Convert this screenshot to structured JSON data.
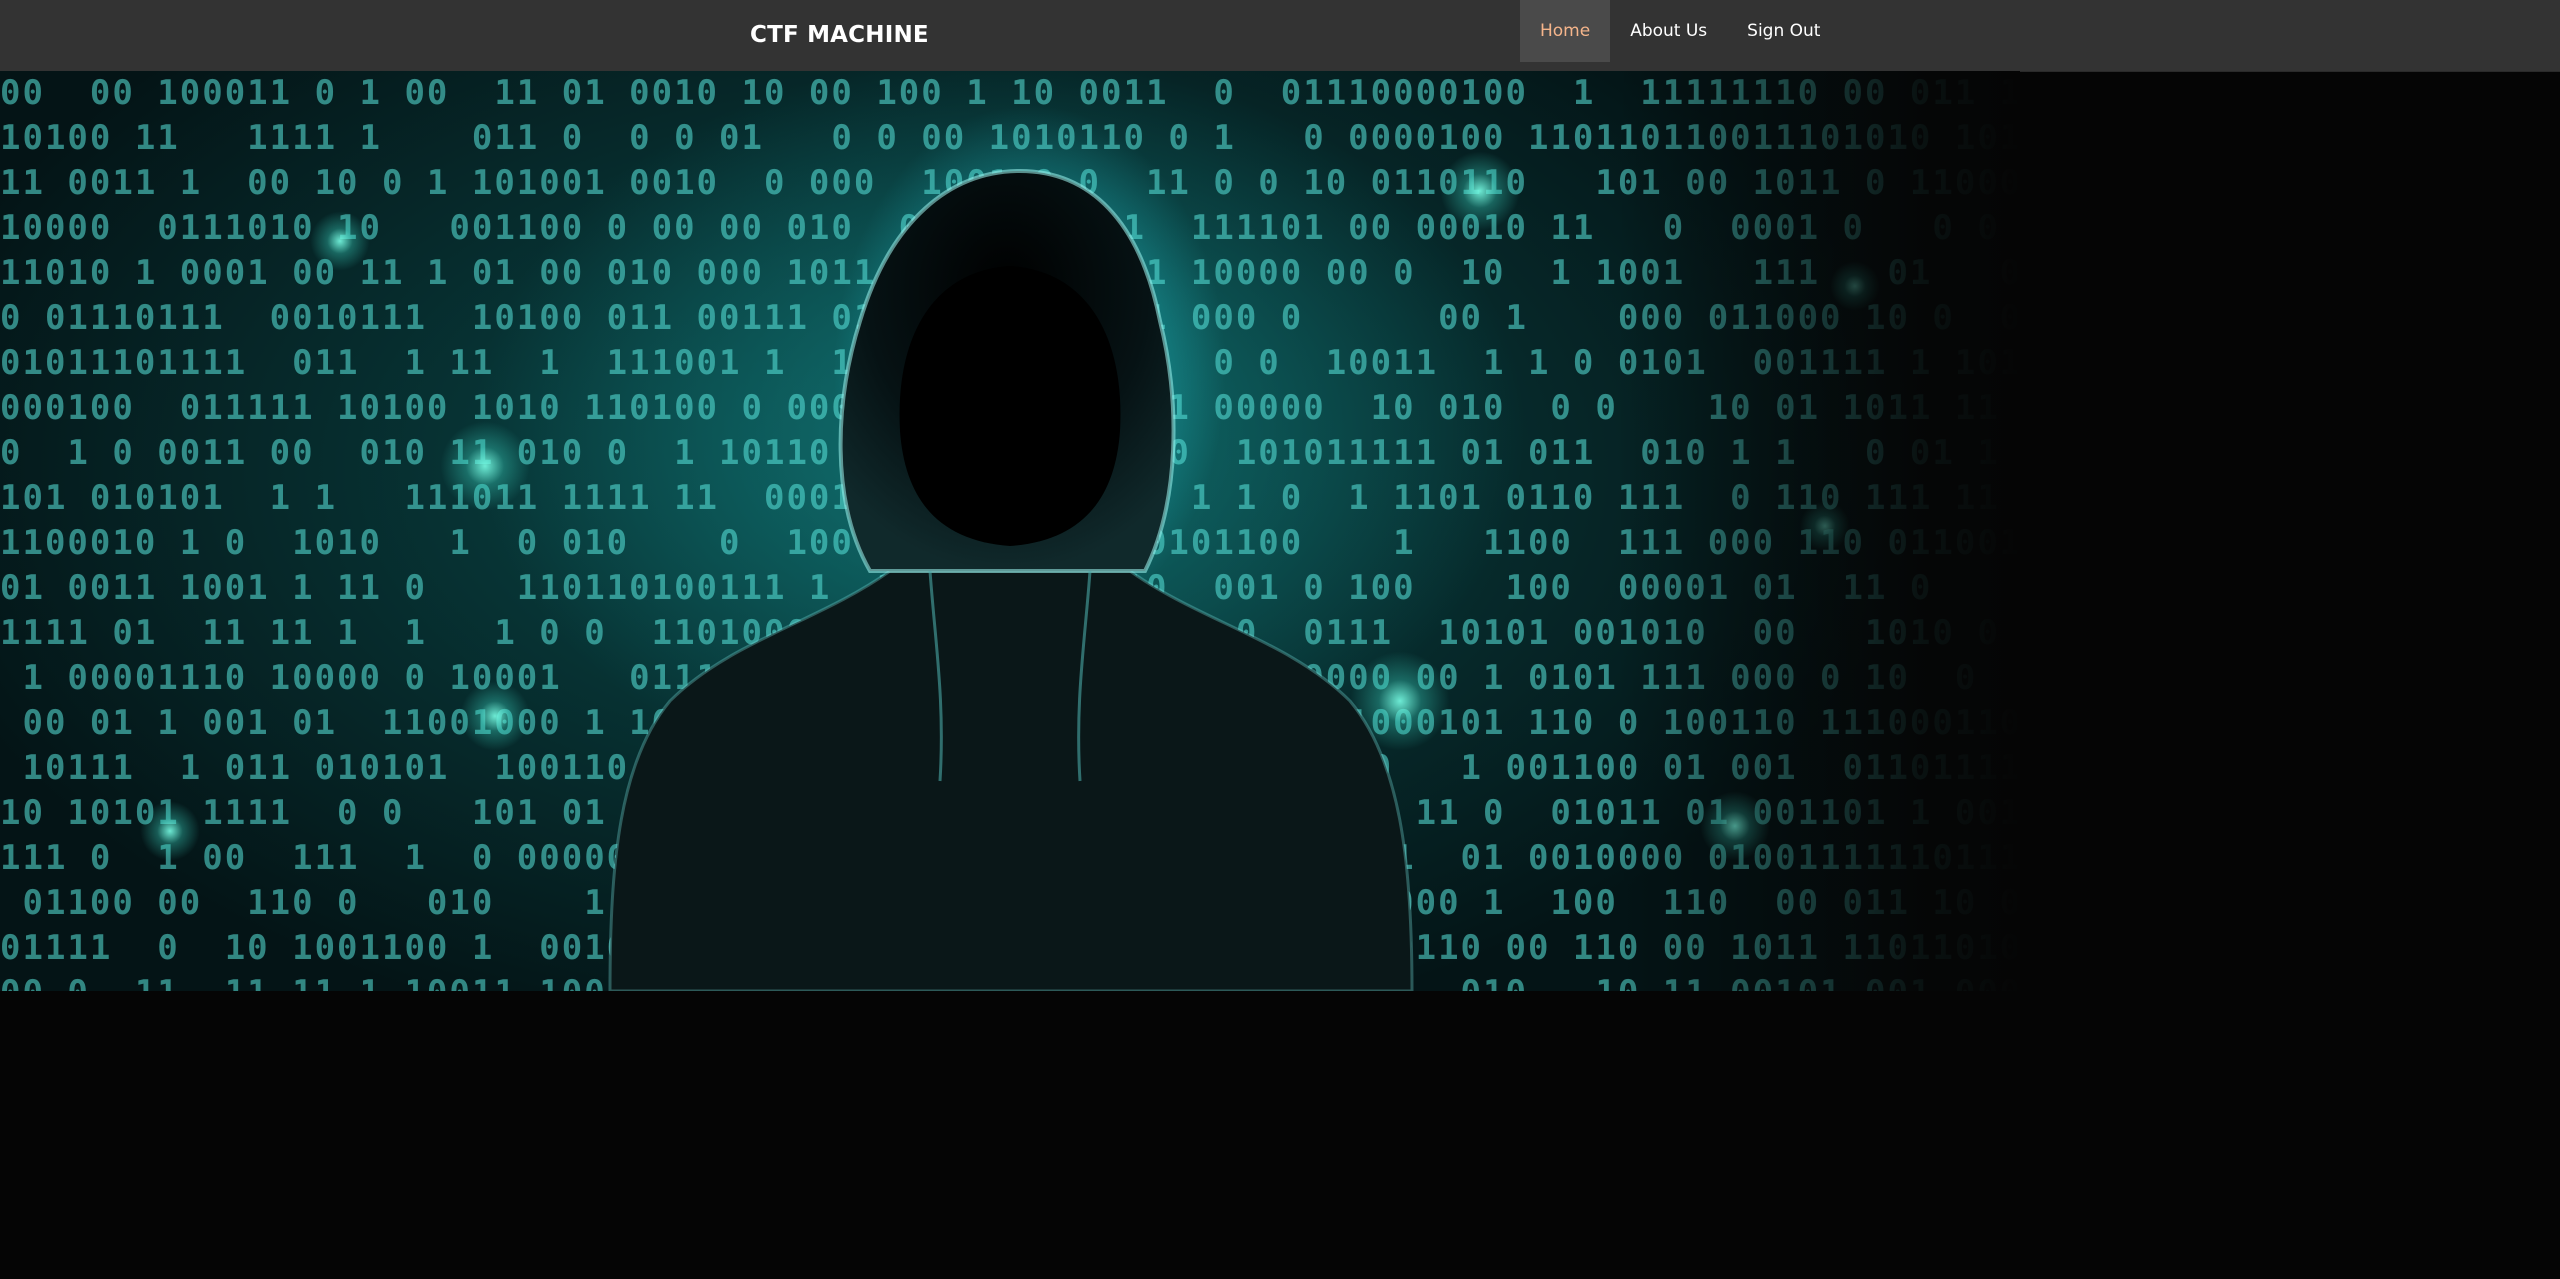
{
  "navbar": {
    "brand": "CTF MACHINE",
    "items": [
      {
        "label": "Home",
        "active": true
      },
      {
        "label": "About Us",
        "active": false
      },
      {
        "label": "Sign Out",
        "active": false
      }
    ]
  },
  "colors": {
    "navbar_bg": "#333333",
    "active_item_bg": "#4a4a4a",
    "active_item_text": "#f5b58b",
    "hero_accent": "#28dce6",
    "page_bg": "#050505"
  },
  "hero": {
    "image_subject": "hooded-hacker-binary-background"
  }
}
